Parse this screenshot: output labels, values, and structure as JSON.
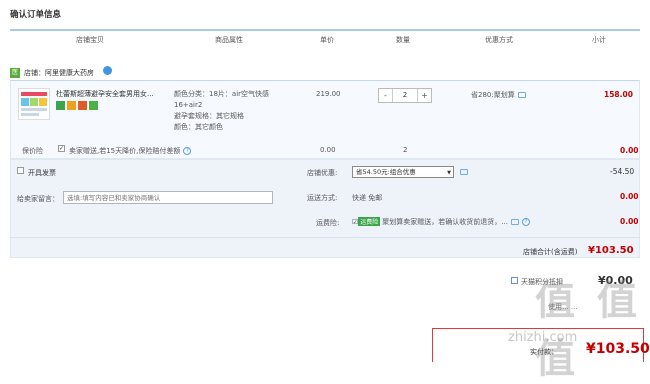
{
  "page_title": "确认订单信息",
  "columns": [
    "店铺宝贝",
    "商品属性",
    "单价",
    "数量",
    "优惠方式",
    "小计"
  ],
  "store": {
    "badge": "医",
    "name": "店铺：阿里健康大药房"
  },
  "item": {
    "name": "杜蕾斯超薄避孕安全套男用女...",
    "props": [
      "颜色分类：18片：air空气快感16+air2",
      "避孕套规格：其它规格",
      "颜色：其它颜色"
    ],
    "price": "219.00",
    "qty_minus": "-",
    "qty": "2",
    "qty_plus": "+",
    "promo": "省280:聚划算",
    "subtotal": "158.00"
  },
  "insurance": {
    "label": "保价险",
    "text": "卖家赠送,若15天降价,保险赔付差额",
    "help": "?",
    "price": "0.00",
    "qty": "2",
    "total": "0.00"
  },
  "invoice": {
    "label": "开具发票"
  },
  "message": {
    "label": "给卖家留言：",
    "placeholder": "选填:填写内容已和卖家协商确认"
  },
  "store_discount": {
    "label": "店铺优惠:",
    "selected": "省54.50元:组合优惠",
    "value": "-54.50"
  },
  "shipping": {
    "label": "运送方式:",
    "value": "快递 免邮",
    "price": "0.00"
  },
  "freight_ins": {
    "label": "运费险:",
    "tag": "运费险",
    "text": "聚划算卖家赠送，若确认收货前退货，...",
    "price": "0.00"
  },
  "store_total": {
    "label": "店铺合计(含运费)",
    "value": "¥103.50"
  },
  "tmall_points": {
    "label": "天猫积分抵扣",
    "value": "¥0.00"
  },
  "hidden_row": "使用... ...",
  "pay": {
    "label": "实付款：",
    "value": "¥103.50"
  },
  "watermark": {
    "big": "值 值 值",
    "small": "zhizhi.com"
  }
}
